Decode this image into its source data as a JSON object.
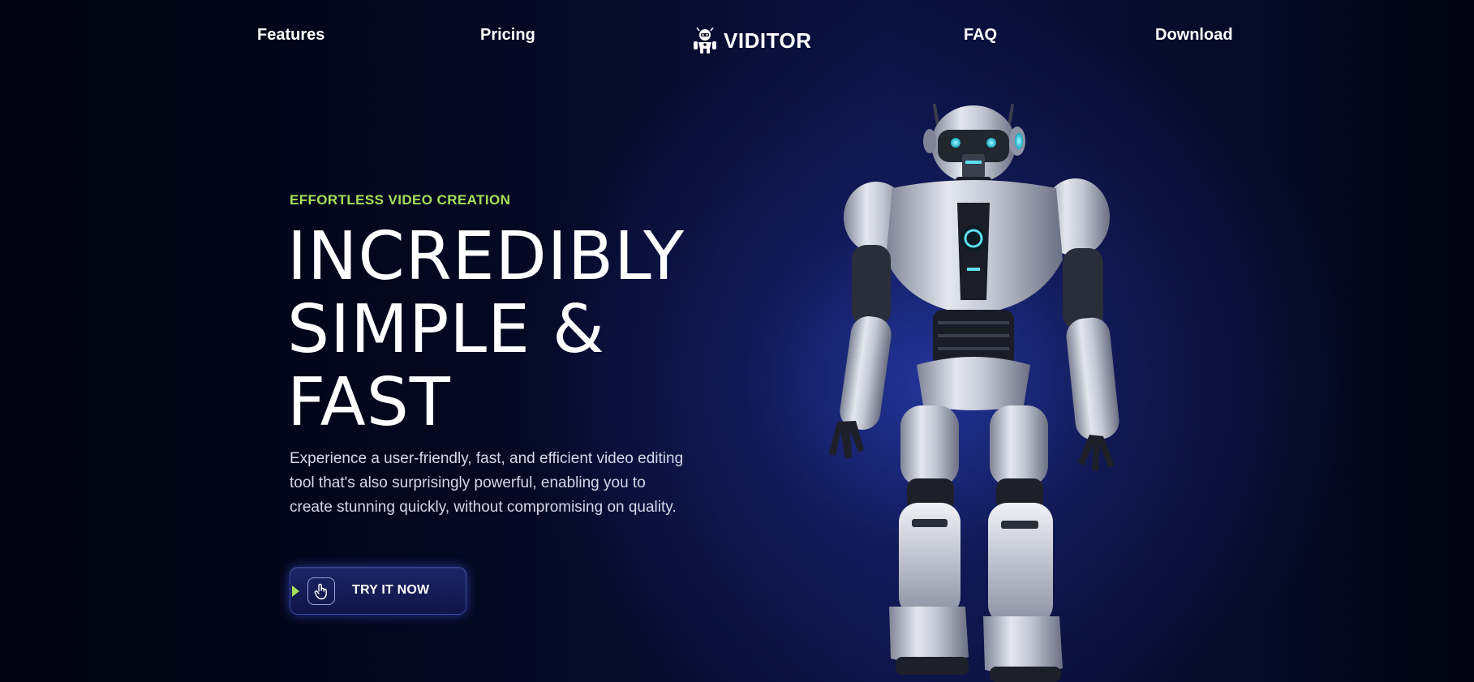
{
  "nav": {
    "features": "Features",
    "pricing": "Pricing",
    "logo_text": "VIDITOR",
    "logo_icon": "robot-head-icon",
    "faq": "FAQ",
    "download": "Download"
  },
  "hero": {
    "eyebrow": "EFFORTLESS VIDEO CREATION",
    "headline_lines": [
      "INCREDIBLY",
      "SIMPLE &",
      "FAST"
    ],
    "description": "Experience a user-friendly, fast, and efficient video editing tool that's also surprisingly powerful, enabling you to create stunning quickly, without compromising on quality.",
    "cta_label": "TRY IT NOW",
    "cta_icon": "tap-hand-icon"
  },
  "colors": {
    "background": "#03061a",
    "glow": "#2a3aaa",
    "accent": "#a6e05a",
    "text": "#ffffff",
    "muted_text": "#d4d8ea",
    "button": "#1c2566"
  }
}
